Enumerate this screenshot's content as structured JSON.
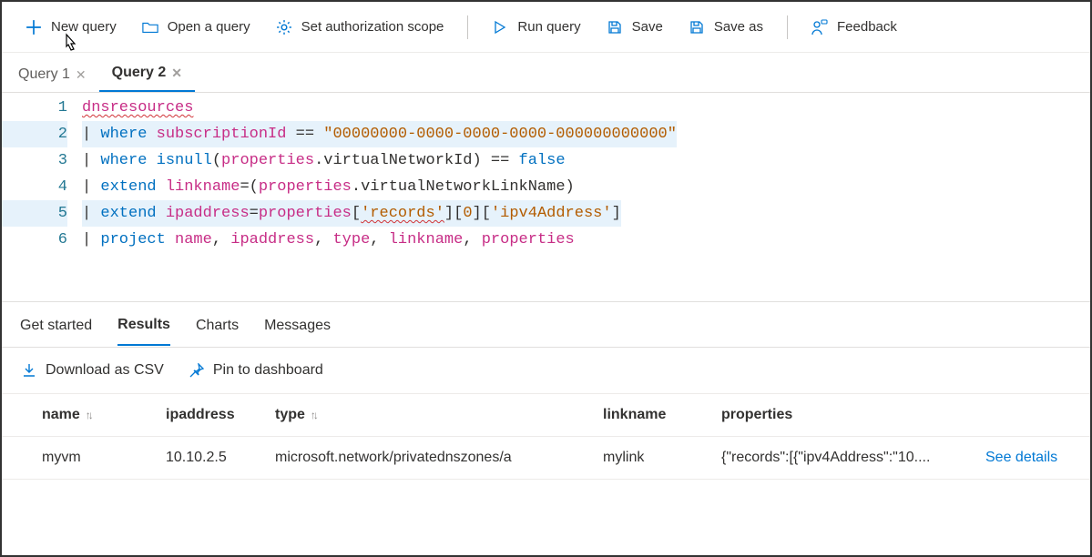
{
  "toolbar": {
    "new_query": "New query",
    "open_query": "Open a query",
    "set_auth": "Set authorization scope",
    "run_query": "Run query",
    "save": "Save",
    "save_as": "Save as",
    "feedback": "Feedback"
  },
  "tabs": [
    {
      "label": "Query 1",
      "active": false
    },
    {
      "label": "Query 2",
      "active": true
    }
  ],
  "editor": {
    "lines": [
      {
        "n": 1,
        "tokens": [
          [
            "id",
            "dnsresources"
          ]
        ]
      },
      {
        "n": 2,
        "tokens": [
          [
            "pipe",
            "| "
          ],
          [
            "kw",
            "where"
          ],
          [
            "txt",
            " "
          ],
          [
            "id",
            "subscriptionId"
          ],
          [
            "txt",
            " "
          ],
          [
            "op",
            "=="
          ],
          [
            "txt",
            " "
          ],
          [
            "str",
            "\"00000000-0000-0000-0000-000000000000\""
          ]
        ]
      },
      {
        "n": 3,
        "tokens": [
          [
            "pipe",
            "| "
          ],
          [
            "kw",
            "where"
          ],
          [
            "txt",
            " "
          ],
          [
            "func",
            "isnull"
          ],
          [
            "punct",
            "("
          ],
          [
            "id",
            "properties"
          ],
          [
            "punct",
            "."
          ],
          [
            "prop",
            "virtualNetworkId"
          ],
          [
            "punct",
            ")"
          ],
          [
            "txt",
            " "
          ],
          [
            "op",
            "=="
          ],
          [
            "txt",
            " "
          ],
          [
            "kw",
            "false"
          ]
        ]
      },
      {
        "n": 4,
        "tokens": [
          [
            "pipe",
            "| "
          ],
          [
            "kw",
            "extend"
          ],
          [
            "txt",
            " "
          ],
          [
            "id",
            "linkname"
          ],
          [
            "op",
            "="
          ],
          [
            "punct",
            "("
          ],
          [
            "id",
            "properties"
          ],
          [
            "punct",
            "."
          ],
          [
            "prop",
            "virtualNetworkLinkName"
          ],
          [
            "punct",
            ")"
          ]
        ]
      },
      {
        "n": 5,
        "tokens": [
          [
            "pipe",
            "| "
          ],
          [
            "kw",
            "extend"
          ],
          [
            "txt",
            " "
          ],
          [
            "id",
            "ipaddress"
          ],
          [
            "op",
            "="
          ],
          [
            "id",
            "properties"
          ],
          [
            "punct",
            "["
          ],
          [
            "str",
            "'records'"
          ],
          [
            "punct",
            "]["
          ],
          [
            "str",
            "0"
          ],
          [
            "punct",
            "]["
          ],
          [
            "str",
            "'ipv4Address'"
          ],
          [
            "punct",
            "]"
          ]
        ]
      },
      {
        "n": 6,
        "tokens": [
          [
            "pipe",
            "| "
          ],
          [
            "kw",
            "project"
          ],
          [
            "txt",
            " "
          ],
          [
            "id",
            "name"
          ],
          [
            "punct",
            ", "
          ],
          [
            "id",
            "ipaddress"
          ],
          [
            "punct",
            ", "
          ],
          [
            "id",
            "type"
          ],
          [
            "punct",
            ", "
          ],
          [
            "id",
            "linkname"
          ],
          [
            "punct",
            ", "
          ],
          [
            "id",
            "properties"
          ]
        ]
      }
    ]
  },
  "result_tabs": {
    "get_started": "Get started",
    "results": "Results",
    "charts": "Charts",
    "messages": "Messages"
  },
  "result_actions": {
    "download_csv": "Download as CSV",
    "pin_dashboard": "Pin to dashboard"
  },
  "table": {
    "columns": [
      "name",
      "ipaddress",
      "type",
      "linkname",
      "properties"
    ],
    "rows": [
      {
        "name": "myvm",
        "ipaddress": "10.10.2.5",
        "type": "microsoft.network/privatednszones/a",
        "linkname": "mylink",
        "properties": "{\"records\":[{\"ipv4Address\":\"10....",
        "details": "See details"
      }
    ]
  }
}
